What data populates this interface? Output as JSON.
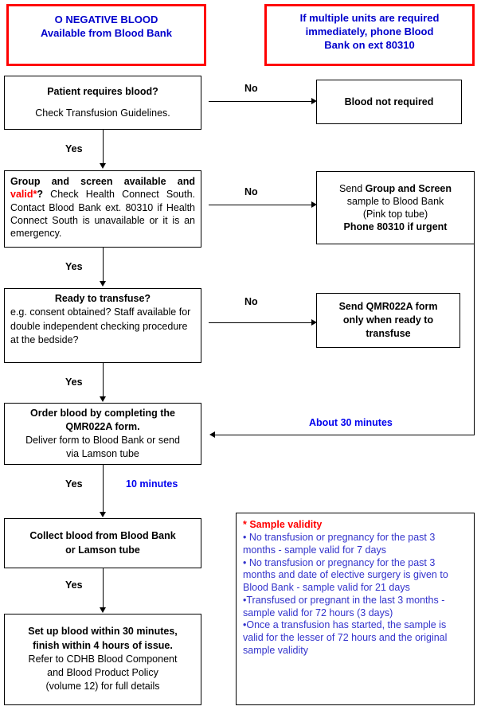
{
  "banners": {
    "o_negative": {
      "line1": "O NEGATIVE BLOOD",
      "line2": "Available from Blood Bank"
    },
    "multiple_units": {
      "line1": "If multiple units are required",
      "line2": "immediately, phone Blood",
      "line3": "Bank on ext 80310"
    }
  },
  "nodes": {
    "patient_requires_blood": {
      "title": "Patient requires blood?",
      "body": "Check Transfusion Guidelines."
    },
    "blood_not_required": {
      "title": "Blood not required"
    },
    "group_and_screen": {
      "bold_lead": "Group and screen available and",
      "red_word": "valid*",
      "bold_q": "?",
      "body": " Check Health Connect South.  Contact Blood Bank ext. 80310 if Health Connect South is unavailable or it is an emergency."
    },
    "send_group_screen": {
      "line1_pre": "Send ",
      "line1_bold": "Group and Screen",
      "line2": "sample to Blood Bank",
      "line3": "(Pink top tube)",
      "line4_bold": "Phone 80310 if urgent"
    },
    "ready_to_transfuse": {
      "title": "Ready to transfuse?",
      "body": "e.g. consent obtained? Staff available for double independent checking procedure at the bedside?"
    },
    "send_qmr_form": {
      "line1": "Send QMR022A form",
      "line2": "only when ready to",
      "line3": "transfuse"
    },
    "order_blood": {
      "bold_line1": "Order blood by completing the",
      "bold_line2": "QMR022A form.",
      "body_line1": "Deliver form to Blood Bank or send",
      "body_line2": "via Lamson tube"
    },
    "collect_blood": {
      "line1": "Collect blood from Blood Bank",
      "line2": "or Lamson tube"
    },
    "set_up_blood": {
      "bold_line1": "Set up blood within 30 minutes,",
      "bold_line2": "finish within 4 hours of issue.",
      "body_line1": "Refer to CDHB Blood Component",
      "body_line2": "and Blood Product Policy",
      "body_line3": "(volume 12) for full details"
    }
  },
  "edges": {
    "no_1": "No",
    "no_2": "No",
    "no_3": "No",
    "yes_1": "Yes",
    "yes_2": "Yes",
    "yes_3": "Yes",
    "yes_4": "Yes",
    "yes_5": "Yes",
    "about_30_minutes": "About 30 minutes",
    "ten_minutes": "10 minutes"
  },
  "note": {
    "heading": "* Sample validity",
    "bullets": [
      "• No transfusion or pregnancy for the past 3 months - sample valid for 7 days",
      "• No transfusion or pregnancy for the past 3 months and date of elective surgery is given to Blood Bank - sample valid for 21 days",
      "•Transfused or pregnant in the last 3 months - sample valid for 72 hours (3 days)",
      "•Once a transfusion has started, the sample is valid for the lesser of 72 hours and the original sample validity"
    ]
  },
  "colors": {
    "banner_border": "#ff0000",
    "banner_text": "#0000cc",
    "timing_text": "#0000ee",
    "note_heading": "#ff0000",
    "note_body": "#3333cc",
    "box_border": "#000000"
  }
}
